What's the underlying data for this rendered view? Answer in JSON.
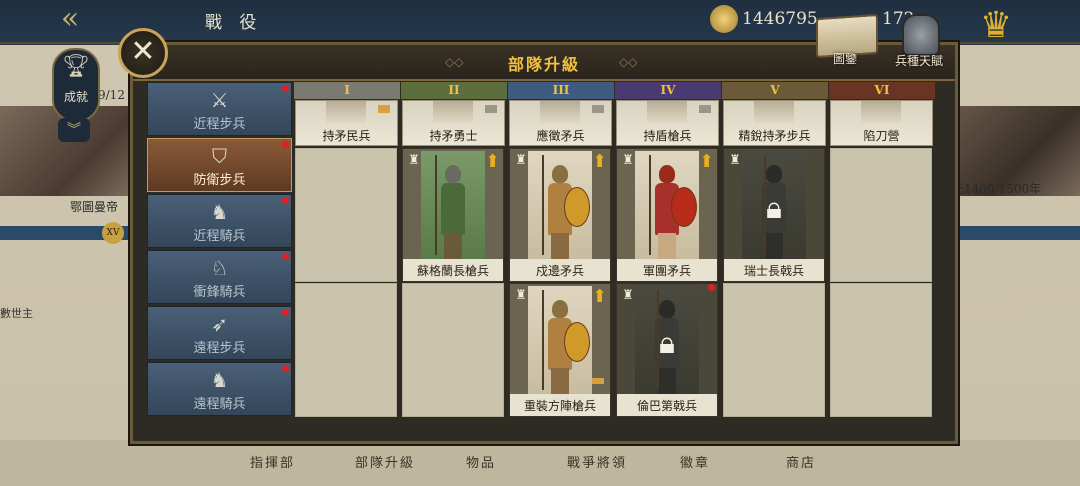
{
  "background": {
    "top_title": "戰 役",
    "gold": "1446795",
    "gems": "172",
    "trophy_label": "成就",
    "progress_count": "9/12",
    "left_event_label": "鄂圖曼帝",
    "right_event_label": "元1400-1500年",
    "left_sub_label": "數世主",
    "level_badge": "XV",
    "bottom_nav": [
      "指揮部",
      "部隊升級",
      "物品",
      "戰爭將領",
      "徽章",
      "商店"
    ]
  },
  "modal": {
    "title": "部隊升級",
    "book_label": "圖鑒",
    "talent_label": "兵種天賦"
  },
  "sidebar": [
    {
      "label": "近程步兵",
      "icon": "crossed-swords-icon",
      "active": false,
      "dot": true
    },
    {
      "label": "防衛步兵",
      "icon": "shield-icon",
      "active": true,
      "dot": true
    },
    {
      "label": "近程騎兵",
      "icon": "horse-head-icon",
      "active": false,
      "dot": true
    },
    {
      "label": "衝鋒騎兵",
      "icon": "lance-horse-icon",
      "active": false,
      "dot": true
    },
    {
      "label": "遠程步兵",
      "icon": "bow-icon",
      "active": false,
      "dot": true
    },
    {
      "label": "遠程騎兵",
      "icon": "horse-archer-icon",
      "active": false,
      "dot": true
    }
  ],
  "tiers": [
    "I",
    "II",
    "III",
    "IV",
    "V",
    "VI"
  ],
  "tier_colors": [
    "#7a7a72",
    "#5c6e3e",
    "#3f5a80",
    "#4a3a72",
    "#6a5a38",
    "#6a3424"
  ],
  "top_row": [
    "持矛民兵",
    "持矛勇士",
    "應徵矛兵",
    "持盾槍兵",
    "精銳持矛步兵",
    "陷刀營"
  ],
  "row2": [
    {
      "label": "蘇格蘭長槍兵",
      "locked": false,
      "upgrade": true
    },
    {
      "label": "戍邊矛兵",
      "locked": false,
      "upgrade": true
    },
    {
      "label": "軍團矛兵",
      "locked": false,
      "upgrade": true
    },
    {
      "label": "瑞士長戟兵",
      "locked": true,
      "upgrade": false
    }
  ],
  "row3": [
    {
      "label": "重裝方陣槍兵",
      "locked": false,
      "upgrade": true
    },
    {
      "label": "倫巴第戟兵",
      "locked": true,
      "upgrade": false
    }
  ]
}
